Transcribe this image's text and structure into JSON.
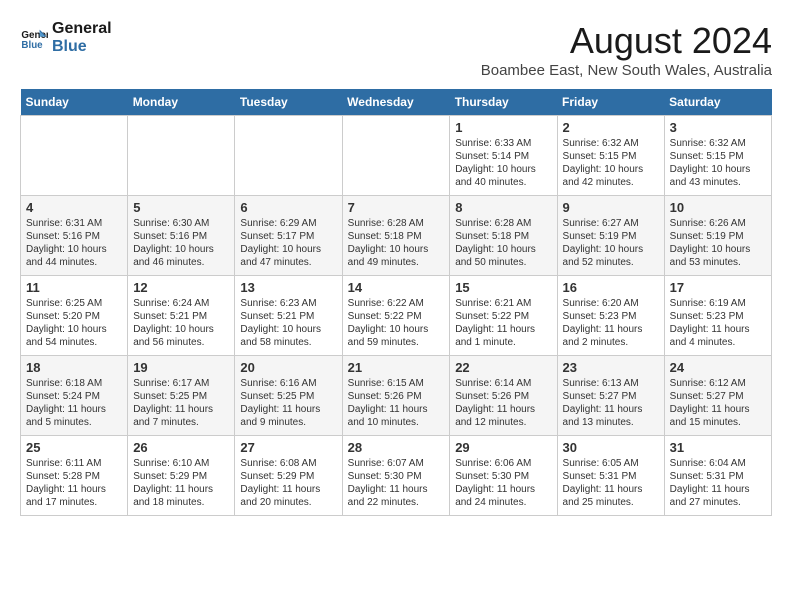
{
  "logo": {
    "line1": "General",
    "line2": "Blue"
  },
  "title": "August 2024",
  "subtitle": "Boambee East, New South Wales, Australia",
  "days_of_week": [
    "Sunday",
    "Monday",
    "Tuesday",
    "Wednesday",
    "Thursday",
    "Friday",
    "Saturday"
  ],
  "weeks": [
    [
      {
        "day": "",
        "info": ""
      },
      {
        "day": "",
        "info": ""
      },
      {
        "day": "",
        "info": ""
      },
      {
        "day": "",
        "info": ""
      },
      {
        "day": "1",
        "info": "Sunrise: 6:33 AM\nSunset: 5:14 PM\nDaylight: 10 hours\nand 40 minutes."
      },
      {
        "day": "2",
        "info": "Sunrise: 6:32 AM\nSunset: 5:15 PM\nDaylight: 10 hours\nand 42 minutes."
      },
      {
        "day": "3",
        "info": "Sunrise: 6:32 AM\nSunset: 5:15 PM\nDaylight: 10 hours\nand 43 minutes."
      }
    ],
    [
      {
        "day": "4",
        "info": "Sunrise: 6:31 AM\nSunset: 5:16 PM\nDaylight: 10 hours\nand 44 minutes."
      },
      {
        "day": "5",
        "info": "Sunrise: 6:30 AM\nSunset: 5:16 PM\nDaylight: 10 hours\nand 46 minutes."
      },
      {
        "day": "6",
        "info": "Sunrise: 6:29 AM\nSunset: 5:17 PM\nDaylight: 10 hours\nand 47 minutes."
      },
      {
        "day": "7",
        "info": "Sunrise: 6:28 AM\nSunset: 5:18 PM\nDaylight: 10 hours\nand 49 minutes."
      },
      {
        "day": "8",
        "info": "Sunrise: 6:28 AM\nSunset: 5:18 PM\nDaylight: 10 hours\nand 50 minutes."
      },
      {
        "day": "9",
        "info": "Sunrise: 6:27 AM\nSunset: 5:19 PM\nDaylight: 10 hours\nand 52 minutes."
      },
      {
        "day": "10",
        "info": "Sunrise: 6:26 AM\nSunset: 5:19 PM\nDaylight: 10 hours\nand 53 minutes."
      }
    ],
    [
      {
        "day": "11",
        "info": "Sunrise: 6:25 AM\nSunset: 5:20 PM\nDaylight: 10 hours\nand 54 minutes."
      },
      {
        "day": "12",
        "info": "Sunrise: 6:24 AM\nSunset: 5:21 PM\nDaylight: 10 hours\nand 56 minutes."
      },
      {
        "day": "13",
        "info": "Sunrise: 6:23 AM\nSunset: 5:21 PM\nDaylight: 10 hours\nand 58 minutes."
      },
      {
        "day": "14",
        "info": "Sunrise: 6:22 AM\nSunset: 5:22 PM\nDaylight: 10 hours\nand 59 minutes."
      },
      {
        "day": "15",
        "info": "Sunrise: 6:21 AM\nSunset: 5:22 PM\nDaylight: 11 hours\nand 1 minute."
      },
      {
        "day": "16",
        "info": "Sunrise: 6:20 AM\nSunset: 5:23 PM\nDaylight: 11 hours\nand 2 minutes."
      },
      {
        "day": "17",
        "info": "Sunrise: 6:19 AM\nSunset: 5:23 PM\nDaylight: 11 hours\nand 4 minutes."
      }
    ],
    [
      {
        "day": "18",
        "info": "Sunrise: 6:18 AM\nSunset: 5:24 PM\nDaylight: 11 hours\nand 5 minutes."
      },
      {
        "day": "19",
        "info": "Sunrise: 6:17 AM\nSunset: 5:25 PM\nDaylight: 11 hours\nand 7 minutes."
      },
      {
        "day": "20",
        "info": "Sunrise: 6:16 AM\nSunset: 5:25 PM\nDaylight: 11 hours\nand 9 minutes."
      },
      {
        "day": "21",
        "info": "Sunrise: 6:15 AM\nSunset: 5:26 PM\nDaylight: 11 hours\nand 10 minutes."
      },
      {
        "day": "22",
        "info": "Sunrise: 6:14 AM\nSunset: 5:26 PM\nDaylight: 11 hours\nand 12 minutes."
      },
      {
        "day": "23",
        "info": "Sunrise: 6:13 AM\nSunset: 5:27 PM\nDaylight: 11 hours\nand 13 minutes."
      },
      {
        "day": "24",
        "info": "Sunrise: 6:12 AM\nSunset: 5:27 PM\nDaylight: 11 hours\nand 15 minutes."
      }
    ],
    [
      {
        "day": "25",
        "info": "Sunrise: 6:11 AM\nSunset: 5:28 PM\nDaylight: 11 hours\nand 17 minutes."
      },
      {
        "day": "26",
        "info": "Sunrise: 6:10 AM\nSunset: 5:29 PM\nDaylight: 11 hours\nand 18 minutes."
      },
      {
        "day": "27",
        "info": "Sunrise: 6:08 AM\nSunset: 5:29 PM\nDaylight: 11 hours\nand 20 minutes."
      },
      {
        "day": "28",
        "info": "Sunrise: 6:07 AM\nSunset: 5:30 PM\nDaylight: 11 hours\nand 22 minutes."
      },
      {
        "day": "29",
        "info": "Sunrise: 6:06 AM\nSunset: 5:30 PM\nDaylight: 11 hours\nand 24 minutes."
      },
      {
        "day": "30",
        "info": "Sunrise: 6:05 AM\nSunset: 5:31 PM\nDaylight: 11 hours\nand 25 minutes."
      },
      {
        "day": "31",
        "info": "Sunrise: 6:04 AM\nSunset: 5:31 PM\nDaylight: 11 hours\nand 27 minutes."
      }
    ]
  ]
}
